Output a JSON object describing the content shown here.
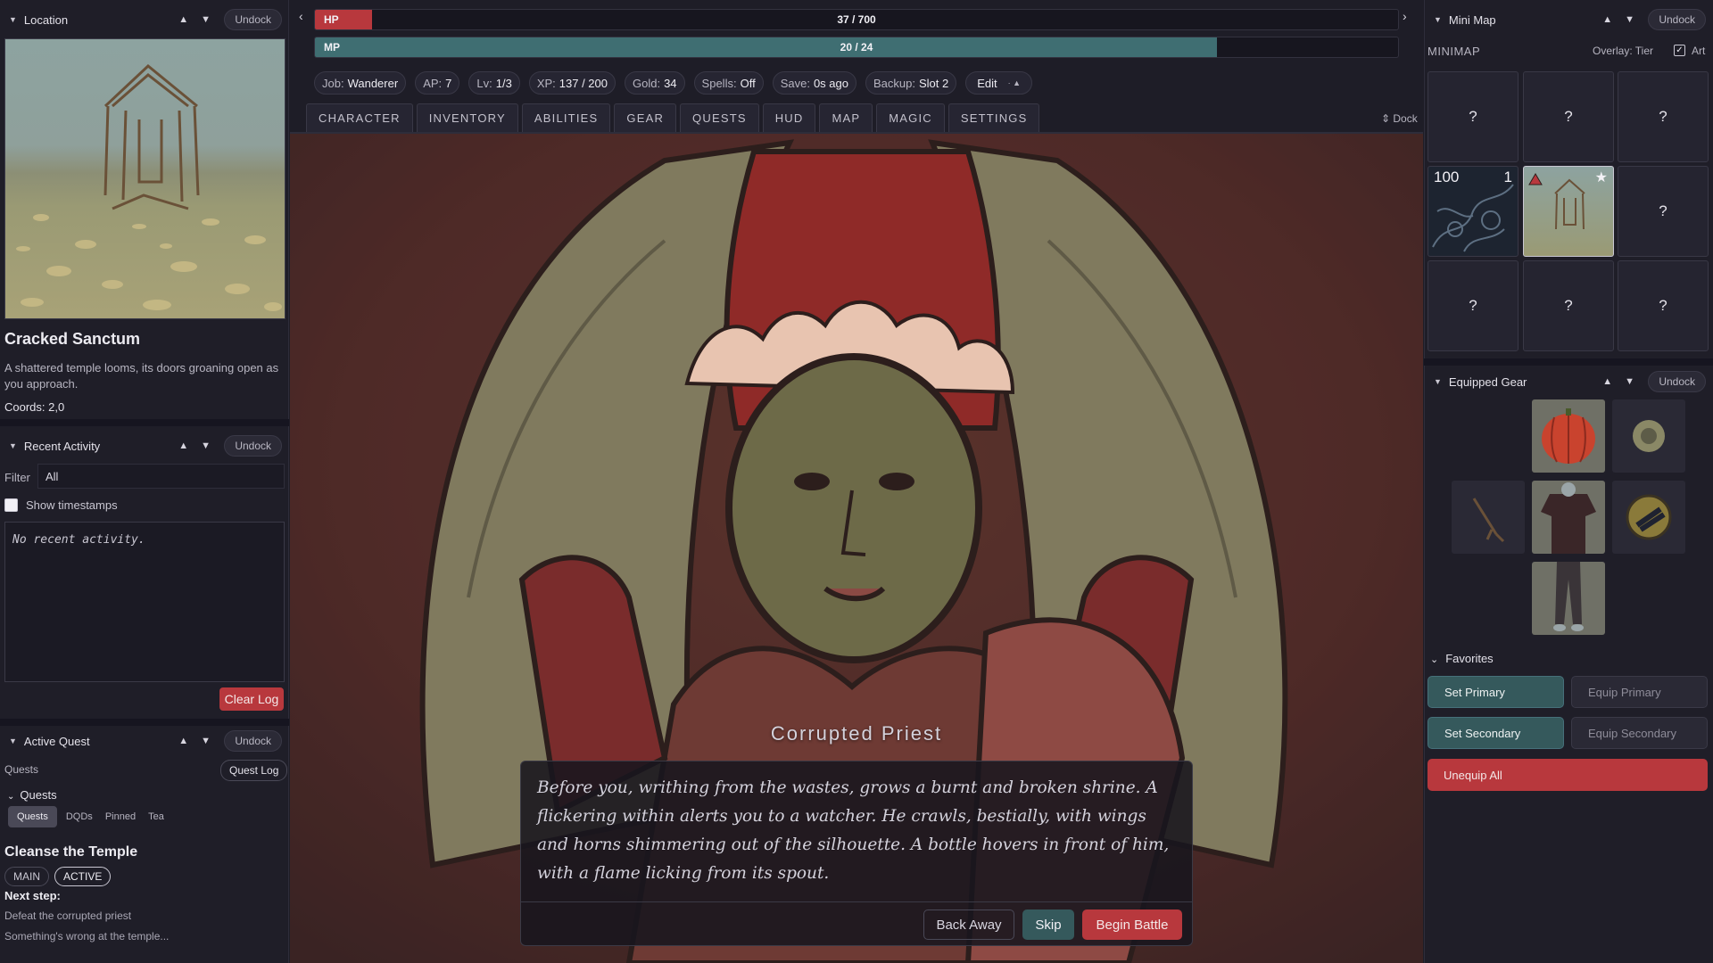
{
  "left": {
    "location": {
      "header": "Location",
      "undock": "Undock",
      "title": "Cracked Sanctum",
      "description": "A shattered temple looms, its doors groaning open as you approach.",
      "coords": "Coords: 2,0"
    },
    "activity": {
      "header": "Recent Activity",
      "undock": "Undock",
      "filter_label": "Filter",
      "filter_value": "All",
      "timestamps_label": "Show timestamps",
      "log_text": "No recent activity.",
      "clear_button": "Clear Log"
    },
    "quest": {
      "header": "Active Quest",
      "undock": "Undock",
      "quests_label": "Quests",
      "quest_log_button": "Quest Log",
      "section_label": "Quests",
      "filter_tabs": [
        "Quests",
        "DQDs",
        "Pinned",
        "Tea"
      ],
      "title": "Cleanse the Temple",
      "tags": [
        "MAIN",
        "ACTIVE"
      ],
      "next_step_label": "Next step:",
      "next_step": "Defeat the corrupted priest",
      "teaser": "Something's wrong at the temple..."
    }
  },
  "top": {
    "hp": {
      "label": "HP",
      "value_text": "37 / 700",
      "fraction": 0.053,
      "color": "#b8383d"
    },
    "mp": {
      "label": "MP",
      "value_text": "20 / 24",
      "fraction": 0.833,
      "color": "#3f6e72"
    },
    "stats": [
      {
        "label": "Job:",
        "value": "Wanderer"
      },
      {
        "label": "AP:",
        "value": "7"
      },
      {
        "label": "Lv:",
        "value": "1/3"
      },
      {
        "label": "XP:",
        "value": "137 / 200"
      },
      {
        "label": "Gold:",
        "value": "34"
      },
      {
        "label": "Spells:",
        "value": "Off"
      },
      {
        "label": "Save:",
        "value": "0s ago"
      },
      {
        "label": "Backup:",
        "value": "Slot 2"
      }
    ],
    "edit_label": "Edit",
    "tabs": [
      "CHARACTER",
      "INVENTORY",
      "ABILITIES",
      "GEAR",
      "QUESTS",
      "HUD",
      "MAP",
      "MAGIC",
      "SETTINGS"
    ],
    "dock_label": "⇕ Dock"
  },
  "encounter": {
    "enemy_name": "Corrupted Priest",
    "text": "Before you, writhing from the wastes, grows a burnt and broken shrine. A flickering within alerts you to a watcher. He crawls, bestially, with wings and horns shimmering out of the silhouette. A bottle hovers in front of him, with a flame licking from its spout.",
    "buttons": {
      "back_away": "Back Away",
      "skip": "Skip",
      "begin": "Begin Battle"
    }
  },
  "right": {
    "minimap": {
      "header": "Mini Map",
      "undock": "Undock",
      "label": "MINIMAP",
      "overlay": "Overlay: Tier",
      "art_label": "Art",
      "art_checked": true,
      "unknown": "?",
      "cell4_number": "100",
      "cell4_badge": "1",
      "star": "★"
    },
    "gear": {
      "header": "Equipped Gear",
      "undock": "Undock",
      "favorites_label": "Favorites",
      "buttons": {
        "set_primary": "Set Primary",
        "equip_primary": "Equip Primary",
        "set_secondary": "Set Secondary",
        "equip_secondary": "Equip Secondary",
        "unequip_all": "Unequip All"
      }
    }
  },
  "colors": {
    "accent_teal": "#35595c",
    "danger": "#b8383d",
    "bg": "#1e1d27"
  }
}
